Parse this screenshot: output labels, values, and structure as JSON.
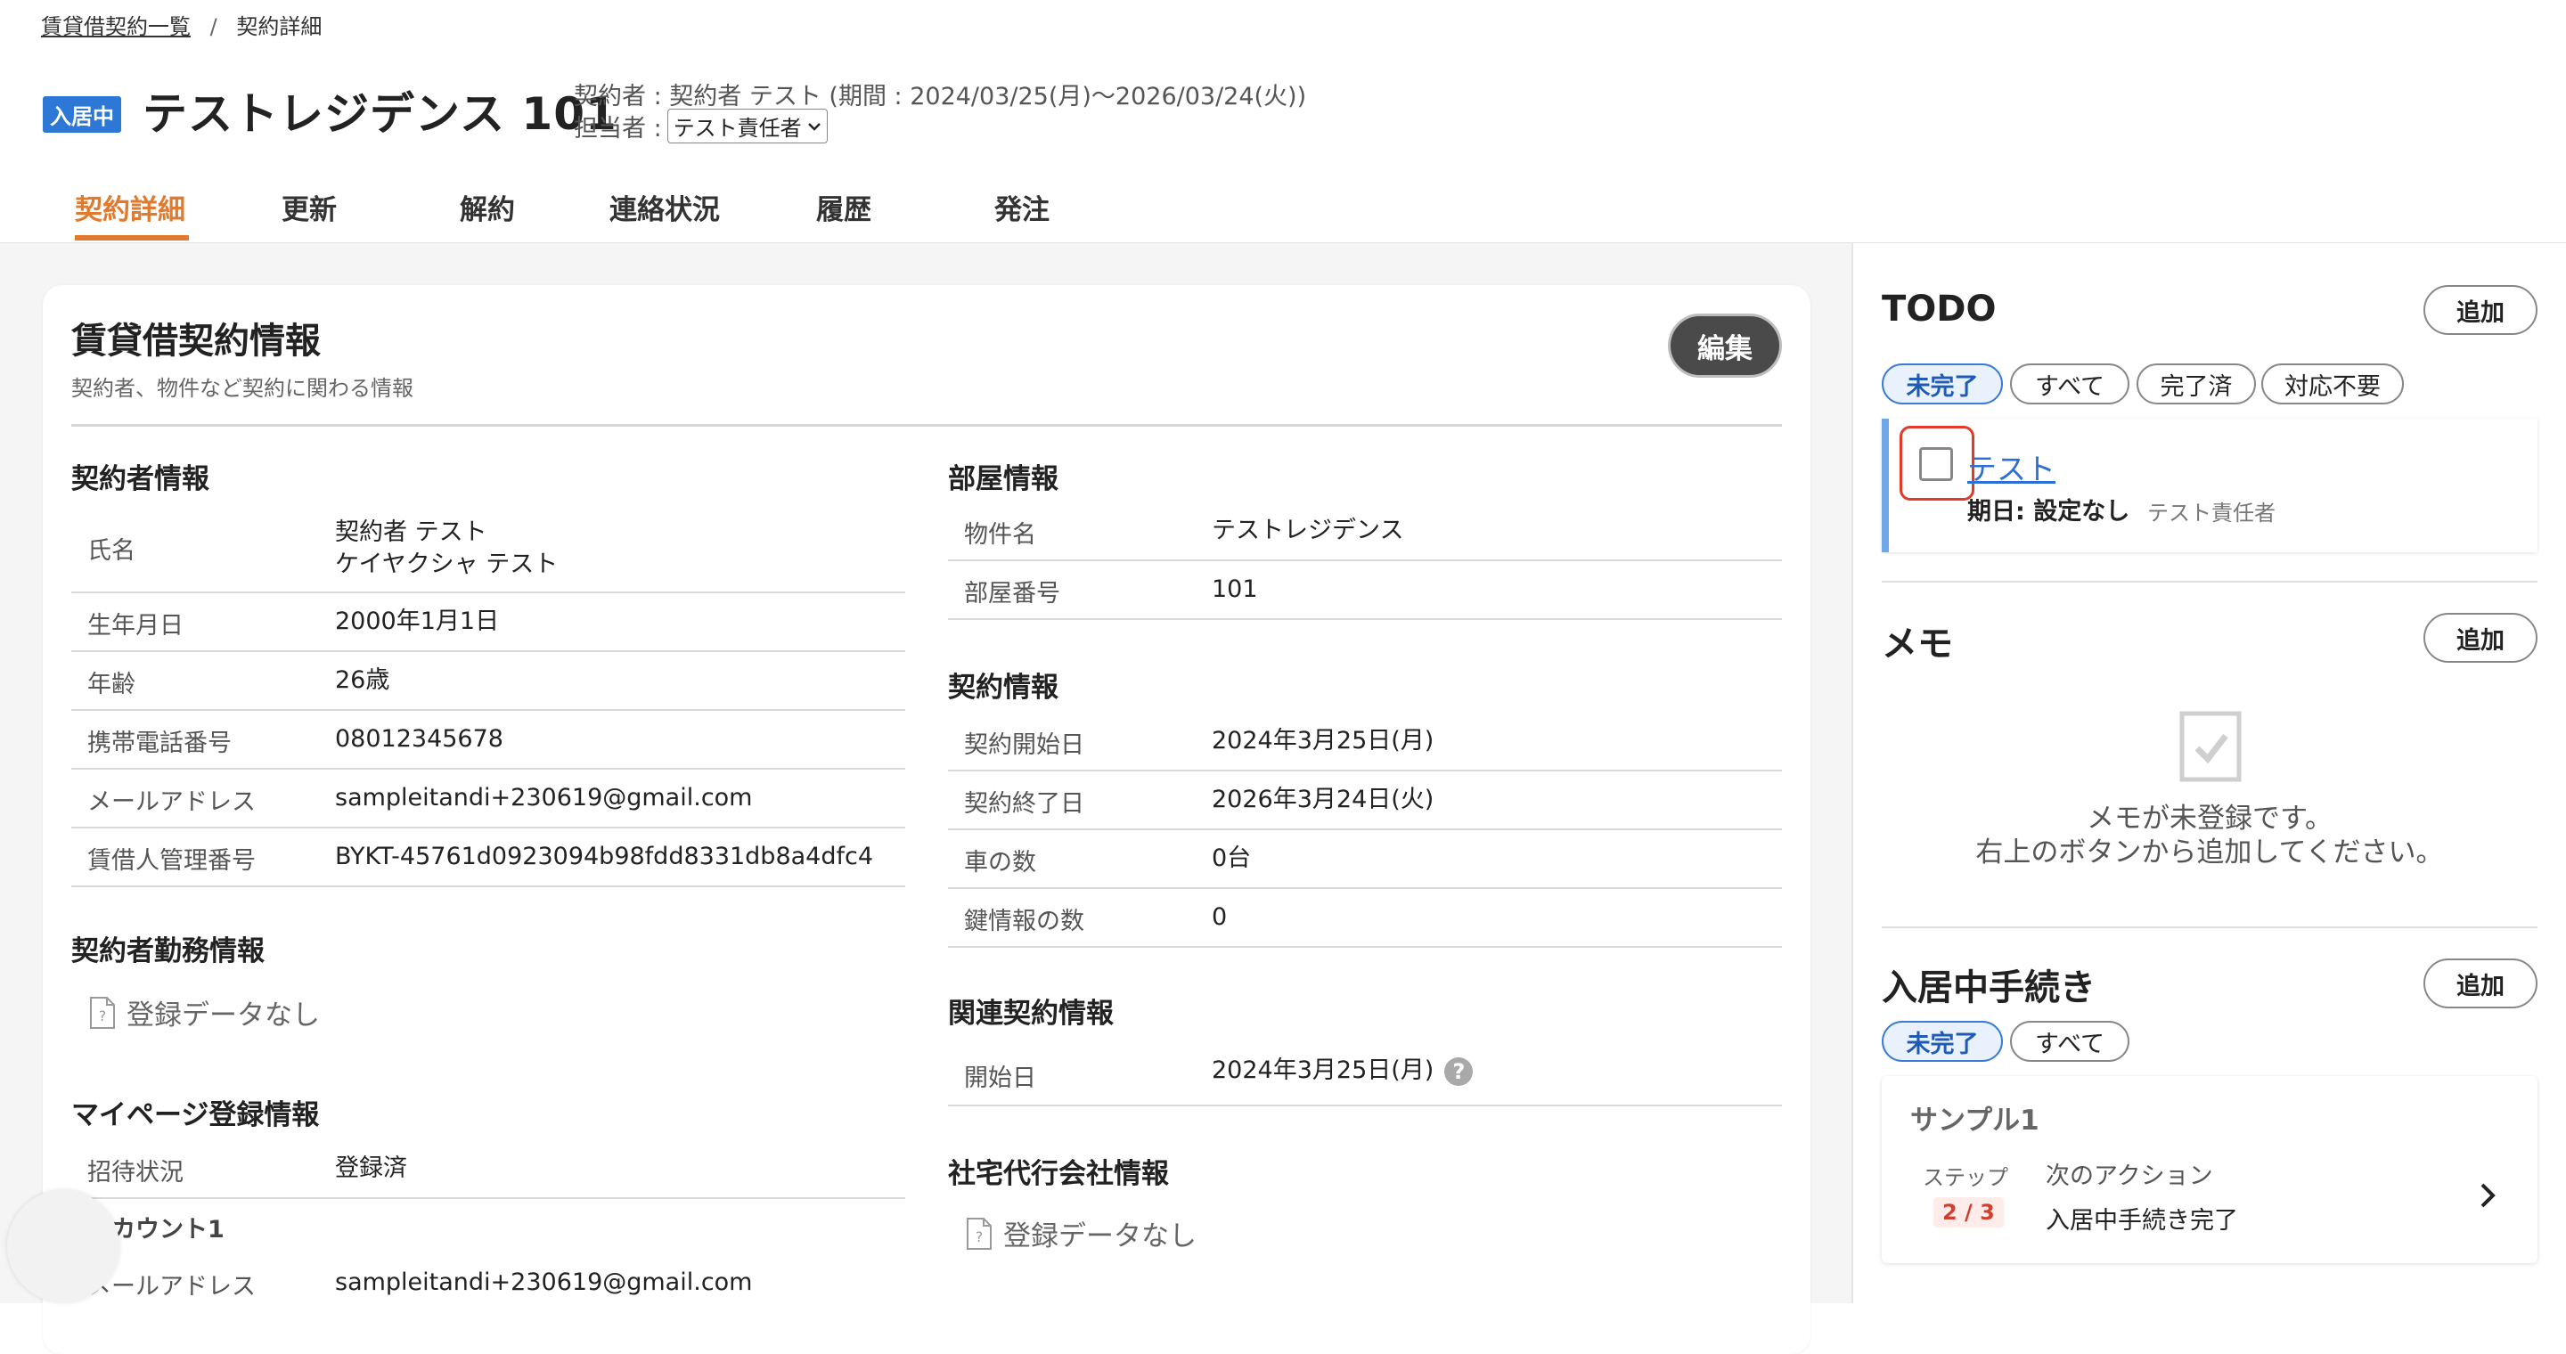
{
  "breadcrumb": {
    "parent": "賃貸借契約一覧",
    "separator": "/",
    "current": "契約詳細"
  },
  "header": {
    "status_badge": "入居中",
    "title": "テストレジデンス 101",
    "contract_meta": "契約者 : 契約者 テスト (期間 : 2024/03/25(月)〜2026/03/24(火))",
    "assignee_label": "担当者 :",
    "assignee_value": "テスト責任者"
  },
  "tabs": [
    {
      "label": "契約詳細",
      "active": true
    },
    {
      "label": "更新"
    },
    {
      "label": "解約"
    },
    {
      "label": "連絡状況"
    },
    {
      "label": "履歴"
    },
    {
      "label": "発注"
    }
  ],
  "card": {
    "title": "賃貸借契約情報",
    "subtitle": "契約者、物件など契約に関わる情報",
    "edit_label": "編集"
  },
  "contractor": {
    "title": "契約者情報",
    "rows": [
      {
        "label": "氏名",
        "value": "契約者 テスト",
        "value2": "ケイヤクシャ テスト"
      },
      {
        "label": "生年月日",
        "value": "2000年1月1日"
      },
      {
        "label": "年齢",
        "value": "26歳"
      },
      {
        "label": "携帯電話番号",
        "value": "08012345678"
      },
      {
        "label": "メールアドレス",
        "value": "sampleitandi+230619@gmail.com"
      },
      {
        "label": "賃借人管理番号",
        "value": "BYKT-45761d0923094b98fdd8331db8a4dfc4"
      }
    ]
  },
  "work": {
    "title": "契約者勤務情報",
    "empty": "登録データなし"
  },
  "mypage": {
    "title": "マイページ登録情報",
    "invite_label": "招待状況",
    "invite_value": "登録済",
    "account_title": "アカウント1",
    "email_label": "メールアドレス",
    "email_value": "sampleitandi+230619@gmail.com"
  },
  "room": {
    "title": "部屋情報",
    "rows": [
      {
        "label": "物件名",
        "value": "テストレジデンス"
      },
      {
        "label": "部屋番号",
        "value": "101"
      }
    ]
  },
  "contract": {
    "title": "契約情報",
    "rows": [
      {
        "label": "契約開始日",
        "value": "2024年3月25日(月)"
      },
      {
        "label": "契約終了日",
        "value": "2026年3月24日(火)"
      },
      {
        "label": "車の数",
        "value": "0台"
      },
      {
        "label": "鍵情報の数",
        "value": "0"
      }
    ]
  },
  "related": {
    "title": "関連契約情報",
    "start_label": "開始日",
    "start_value": "2024年3月25日(月)",
    "help": "?"
  },
  "company": {
    "title": "社宅代行会社情報",
    "empty": "登録データなし"
  },
  "todo": {
    "title": "TODO",
    "add_label": "追加",
    "filters": [
      {
        "label": "未完了",
        "active": true
      },
      {
        "label": "すべて"
      },
      {
        "label": "完了済"
      },
      {
        "label": "対応不要"
      }
    ],
    "item": {
      "title": "テスト",
      "due": "期日: 設定なし",
      "assignee": "テスト責任者"
    }
  },
  "memo": {
    "title": "メモ",
    "add_label": "追加",
    "empty_line1": "メモが未登録です。",
    "empty_line2": "右上のボタンから追加してください。"
  },
  "procedures": {
    "title": "入居中手続き",
    "add_label": "追加",
    "filters": [
      {
        "label": "未完了",
        "active": true
      },
      {
        "label": "すべて"
      }
    ],
    "item": {
      "name": "サンプル1",
      "step_label": "ステップ",
      "step_value": "2 / 3",
      "next_label": "次のアクション",
      "next_value": "入居中手続き完了"
    }
  },
  "colors": {
    "accent": "#e07a2f",
    "brand_blue": "#2d78d6",
    "danger": "#e03a2a"
  }
}
